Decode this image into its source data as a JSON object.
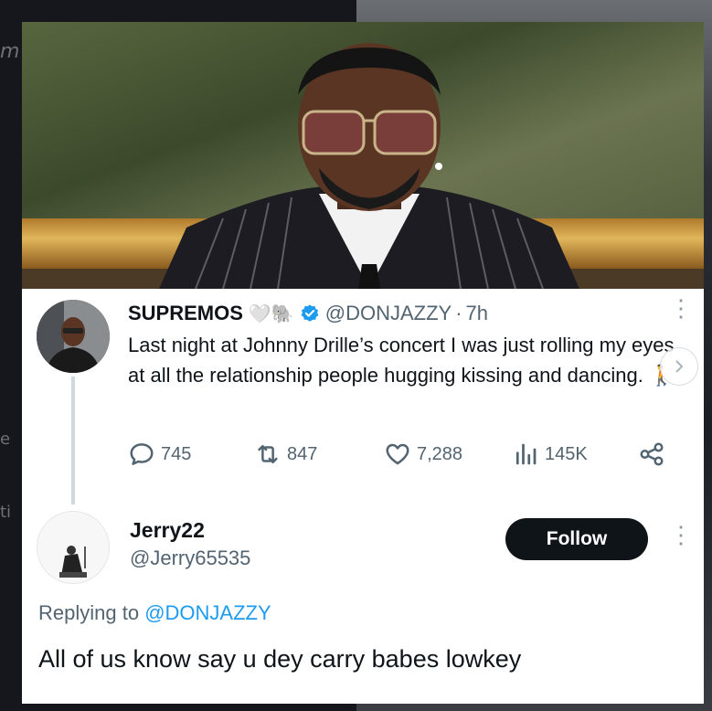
{
  "background": {
    "left_glyph_1": "m",
    "left_glyph_2": "e",
    "left_glyph_3": "ti"
  },
  "tweet": {
    "display_name": "SUPREMOS",
    "name_emojis": "🤍🐘",
    "handle": "@DONJAZZY",
    "separator": "·",
    "time": "7h",
    "text": "Last night at Johnny Drille’s concert I was just rolling my eyes at all the relationship people hugging kissing and dancing.",
    "text_emoji": "🚶",
    "stats": {
      "replies": "745",
      "retweets": "847",
      "likes": "7,288",
      "views": "145K"
    },
    "icons": [
      "reply-icon",
      "retweet-icon",
      "like-icon",
      "views-icon",
      "share-icon",
      "more-icon",
      "verified-icon"
    ]
  },
  "reply": {
    "display_name": "Jerry22",
    "handle": "@Jerry65535",
    "follow_label": "Follow",
    "replying_prefix": "Replying to",
    "replying_mention": "@DONJAZZY",
    "text": "All of us know say u dey carry babes lowkey"
  },
  "colors": {
    "accent": "#1d9bf0",
    "text": "#0f1419",
    "secondary": "#536471",
    "follow_bg": "#0f1419"
  }
}
